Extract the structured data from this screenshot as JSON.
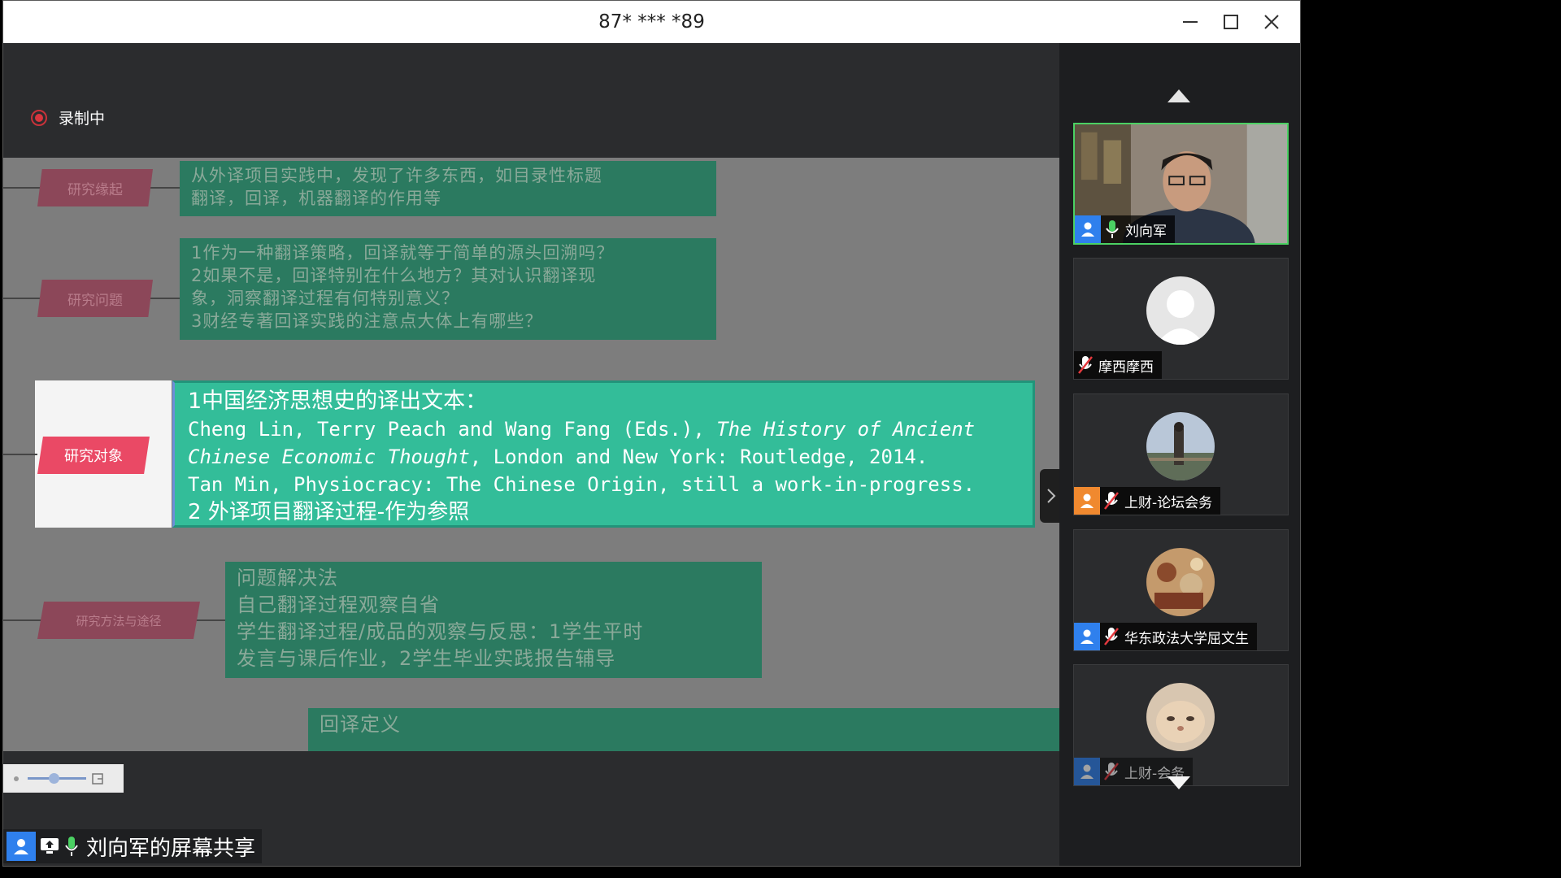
{
  "window": {
    "title": "87* *** *89",
    "controls": [
      "minimize",
      "maximize",
      "close"
    ]
  },
  "recording": {
    "label": "录制中"
  },
  "slide": {
    "nodes": [
      {
        "label": "研究缘起",
        "text": "从外译项目实践中，发现了许多东西，如目录性标题\n翻译，回译，机器翻译的作用等"
      },
      {
        "label": "研究问题",
        "text": "1作为一种翻译策略，回译就等于简单的源头回溯吗？\n2如果不是，回译特别在什么地方？其对认识翻译现\n象，洞察翻译过程有何特别意义？\n3财经专著回译实践的注意点大体上有哪些？"
      },
      {
        "label": "研究方法与途径",
        "text": "问题解决法\n自己翻译过程观察自省\n学生翻译过程/成品的观察与反思：1学生平时\n发言与课后作业，2学生毕业实践报告辅导"
      },
      {
        "label": "",
        "text": "回译定义"
      }
    ],
    "highlight": {
      "label": "研究对象",
      "line1": "1中国经济思想史的译出文本：",
      "line2_a": "Cheng Lin, Terry Peach and Wang Fang (Eds.), ",
      "line2_b": "The History of Ancient",
      "line3_a": "Chinese Economic Thought",
      "line3_b": ", London and New York: Routledge, 2014.",
      "line4": "Tan Min, Physiocracy: The Chinese Origin, still a work-in-progress.",
      "line5": "2 外译项目翻译过程-作为参照"
    }
  },
  "share_strip": {
    "label": "刘向军的屏幕共享"
  },
  "participants": [
    {
      "name": "刘向军",
      "mic": "on",
      "video": true,
      "badge": "blue"
    },
    {
      "name": "摩西摩西",
      "mic": "muted",
      "video": false,
      "badge": ""
    },
    {
      "name": "上财-论坛会务",
      "mic": "muted",
      "video": false,
      "badge": "orange"
    },
    {
      "name": "华东政法大学屈文生",
      "mic": "muted",
      "video": false,
      "badge": "blue"
    },
    {
      "name": "上财-会务",
      "mic": "muted",
      "video": false,
      "badge": "blue"
    }
  ],
  "colors": {
    "accent_green": "#4bd163",
    "record_red": "#d8363e",
    "highlight_teal": "#33bd99",
    "label_pink": "#ea4965",
    "badge_blue": "#2f80ed",
    "badge_orange": "#f0892f"
  }
}
